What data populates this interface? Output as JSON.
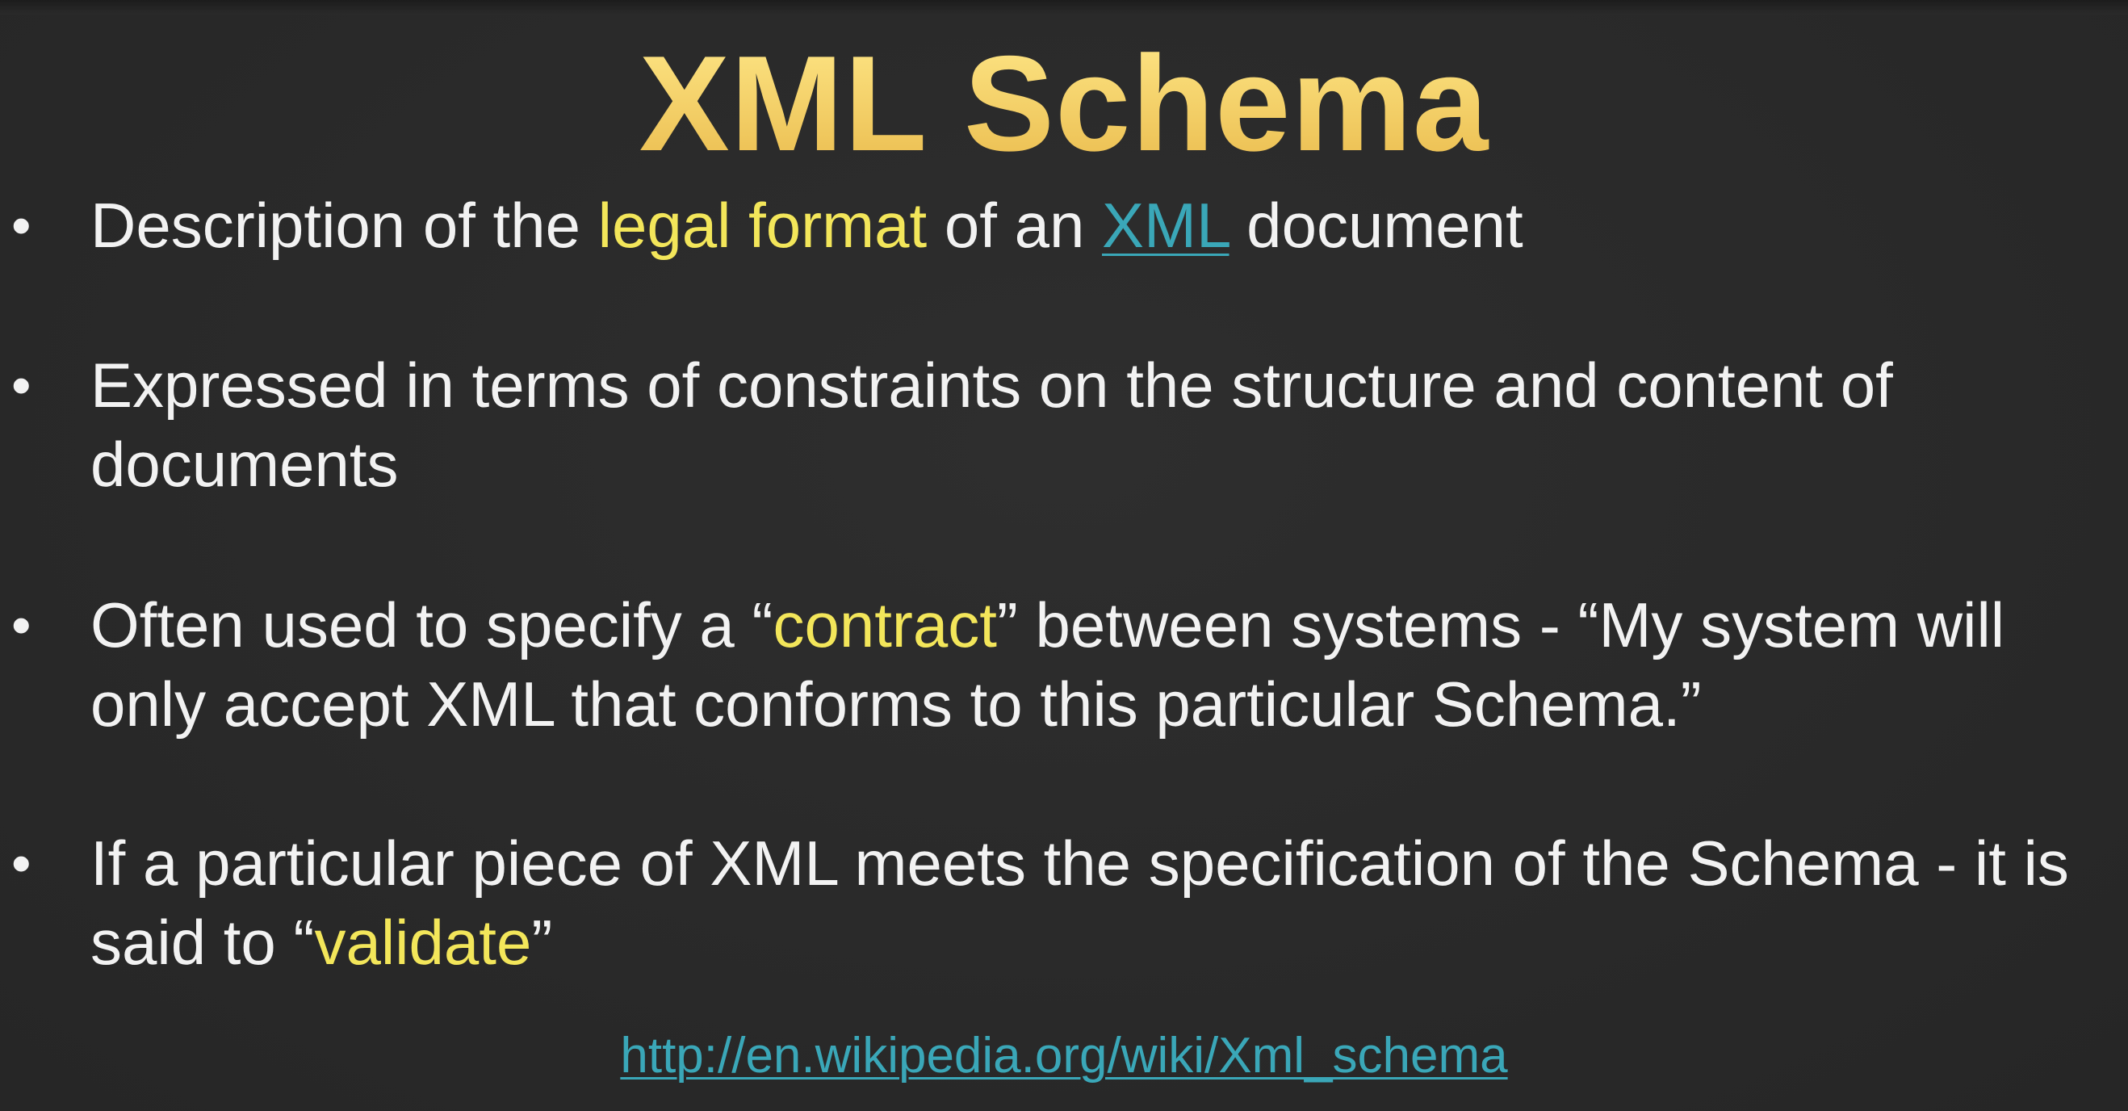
{
  "slide": {
    "title": "XML Schema",
    "bullets": [
      {
        "parts": [
          {
            "text": "Description of the ",
            "style": "plain"
          },
          {
            "text": "legal format",
            "style": "yellow"
          },
          {
            "text": " of an ",
            "style": "plain"
          },
          {
            "text": "XML",
            "style": "link"
          },
          {
            "text": " document",
            "style": "plain"
          }
        ]
      },
      {
        "parts": [
          {
            "text": "Expressed in terms of constraints on the structure and content of documents",
            "style": "plain"
          }
        ]
      },
      {
        "parts": [
          {
            "text": "Often used to specify a “",
            "style": "plain"
          },
          {
            "text": "contract",
            "style": "yellow"
          },
          {
            "text": "” between systems - “My system will only accept XML that conforms to this particular Schema.”",
            "style": "plain"
          }
        ]
      },
      {
        "parts": [
          {
            "text": "If a particular piece of XML meets the specification of the Schema - it is said to “",
            "style": "plain"
          },
          {
            "text": "validate",
            "style": "yellow"
          },
          {
            "text": "”",
            "style": "plain"
          }
        ]
      }
    ],
    "bullet_symbol": "•",
    "footer_link": "http://en.wikipedia.org/wiki/Xml_schema"
  },
  "colors": {
    "background": "#2b2b2b",
    "title": "#f7d46e",
    "text": "#f2f2f2",
    "highlight": "#f3e65a",
    "link": "#3aa7b8"
  }
}
